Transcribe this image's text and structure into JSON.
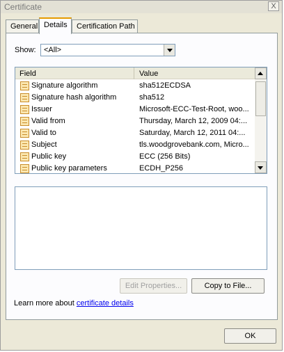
{
  "window": {
    "title": "Certificate",
    "close_glyph": "X"
  },
  "tabs": [
    {
      "label": "General"
    },
    {
      "label": "Details"
    },
    {
      "label": "Certification Path"
    }
  ],
  "details": {
    "show_label": "Show:",
    "show_value": "<All>",
    "columns": {
      "field": "Field",
      "value": "Value"
    },
    "rows": [
      {
        "field": "Signature algorithm",
        "value": "sha512ECDSA"
      },
      {
        "field": "Signature hash algorithm",
        "value": "sha512"
      },
      {
        "field": "Issuer",
        "value": "Microsoft-ECC-Test-Root, woo..."
      },
      {
        "field": "Valid from",
        "value": "Thursday, March 12, 2009 04:..."
      },
      {
        "field": "Valid to",
        "value": "Saturday, March 12, 2011 04:..."
      },
      {
        "field": "Subject",
        "value": "tls.woodgrovebank.com, Micro..."
      },
      {
        "field": "Public key",
        "value": "ECC (256 Bits)"
      },
      {
        "field": "Public key parameters",
        "value": "ECDH_P256"
      }
    ],
    "row_icon": "certificate-field-icon",
    "edit_properties": "Edit Properties...",
    "copy_to_file": "Copy to File...",
    "learn_prefix": "Learn more about",
    "learn_link": "certificate details"
  },
  "footer": {
    "ok": "OK"
  }
}
